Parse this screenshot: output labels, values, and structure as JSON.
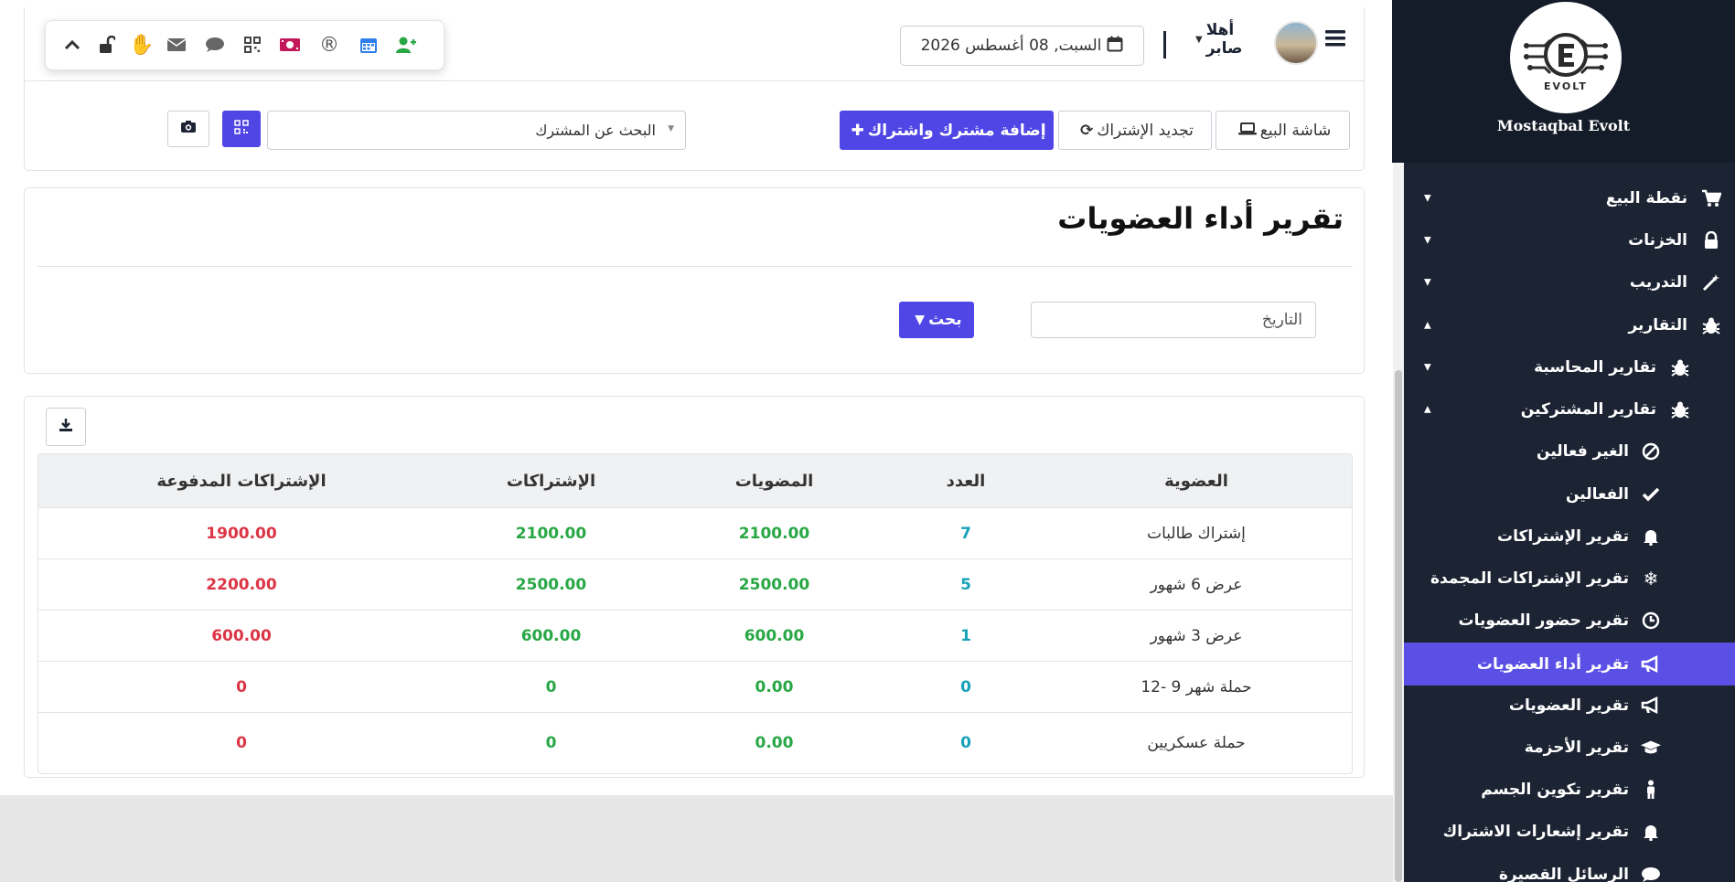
{
  "brand": {
    "name": "Mostaqbal Evolt",
    "logo_text": "EVOLT"
  },
  "sidebar": {
    "items": [
      {
        "label": "نقطة البيع",
        "icon": "cart-icon"
      },
      {
        "label": "الخزنات",
        "icon": "lock-icon"
      },
      {
        "label": "التدريب",
        "icon": "magic-wand-icon"
      },
      {
        "label": "التقارير",
        "icon": "bug-icon"
      },
      {
        "label": "تقارير المحاسبة",
        "icon": "bug-icon"
      },
      {
        "label": "تقارير المشتركين",
        "icon": "bug-icon"
      },
      {
        "label": "الغير فعالين",
        "icon": "ban-icon"
      },
      {
        "label": "الفعالين",
        "icon": "check-icon"
      },
      {
        "label": "تقرير الإشتراكات",
        "icon": "bell-icon"
      },
      {
        "label": "تقرير الإشتراكات المجمدة",
        "icon": "snowflake-icon"
      },
      {
        "label": "تقرير حضور العضويات",
        "icon": "clock-icon"
      },
      {
        "label": "تقرير أداء العضويات",
        "icon": "bullhorn-icon"
      },
      {
        "label": "تقرير العضويات",
        "icon": "bullhorn-icon"
      },
      {
        "label": "تقرير الأحزمة",
        "icon": "graduation-cap-icon"
      },
      {
        "label": "تقرير تكوين الجسم",
        "icon": "person-icon"
      },
      {
        "label": "تقرير إشعارات الاشتراك",
        "icon": "bell-icon"
      },
      {
        "label": "الرسائل القصيرة",
        "icon": "comment-icon"
      }
    ]
  },
  "header": {
    "greeting": "أهلا صابر",
    "date": "السبت, 08 أغسطس 2026",
    "toolbar_icons": [
      "add-user-icon",
      "calendar-icon",
      "registered-icon",
      "money-icon",
      "qrcode-icon",
      "comment-icon",
      "envelope-icon",
      "hand-icon",
      "unlock-icon",
      "chevron-up-icon"
    ]
  },
  "actions": {
    "pos": "شاشة البيع",
    "renew": "تجديد الإشتراك",
    "add": "إضافة مشترك واشتراك",
    "search_placeholder": "البحث عن المشترك"
  },
  "report": {
    "title": "تقرير أداء العضويات",
    "date_placeholder": "التاريخ",
    "search_button": "بحث"
  },
  "table": {
    "headers": [
      "العضوية",
      "العدد",
      "المضويات",
      "الإشتراكات",
      "الإشتراكات المدفوعة"
    ],
    "rows": [
      [
        "إشتراك طالبات",
        "7",
        "2100.00",
        "2100.00",
        "1900.00"
      ],
      [
        "عرض 6 شهور",
        "5",
        "2500.00",
        "2500.00",
        "2200.00"
      ],
      [
        "عرض 3 شهور",
        "1",
        "600.00",
        "600.00",
        "600.00"
      ],
      [
        "حملة شهر 9 -12",
        "0",
        "0.00",
        "0",
        "0"
      ],
      [
        "حملة عسكريين",
        "0",
        "0.00",
        "0",
        "0"
      ]
    ]
  },
  "colors": {
    "accent": "#4f46e5",
    "sidebar_bg": "#1c2434",
    "active": "#5b50e6",
    "green": "#28a745",
    "red": "#dc3545",
    "teal": "#17a2b8"
  }
}
